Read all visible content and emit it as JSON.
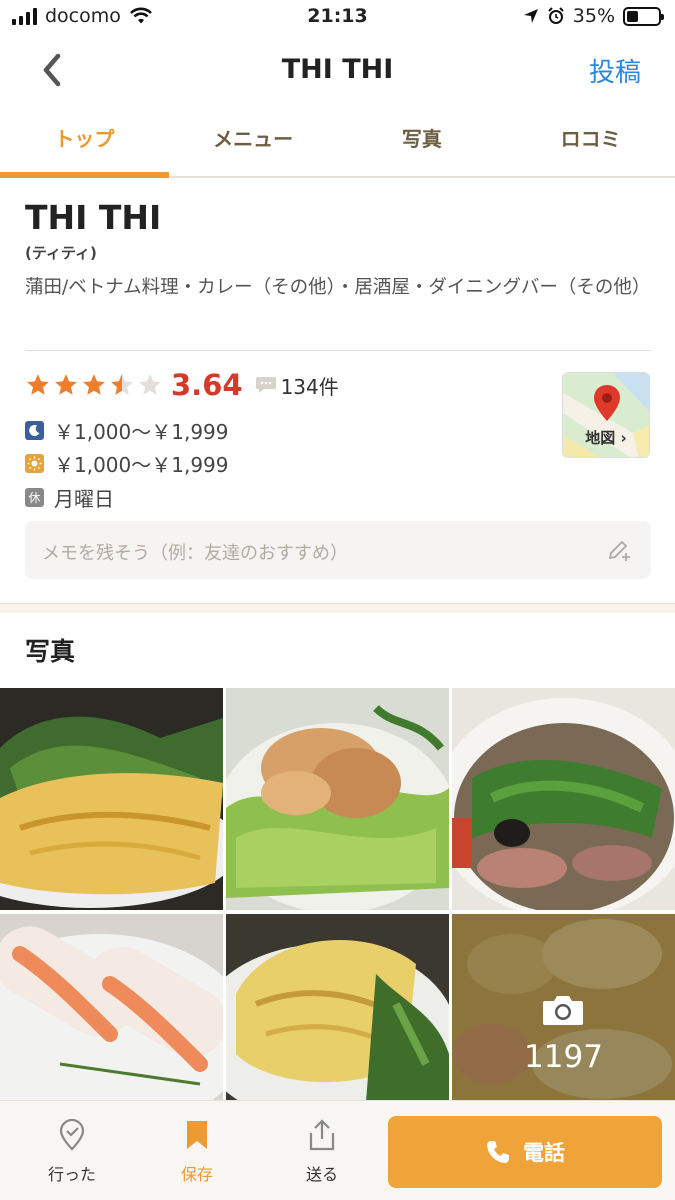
{
  "status": {
    "carrier": "docomo",
    "time": "21:13",
    "battery": "35%",
    "battery_level": 0.35
  },
  "nav": {
    "title": "THI THI",
    "post_label": "投稿"
  },
  "tabs": [
    {
      "label": "トップ",
      "active": true
    },
    {
      "label": "メニュー",
      "active": false
    },
    {
      "label": "写真",
      "active": false
    },
    {
      "label": "ロコミ",
      "active": false
    }
  ],
  "shop": {
    "name": "THI THI",
    "kana": "(ティティ)",
    "genre": "蒲田/ベトナム料理・カレー（その他）・居酒屋・ダイニングバー（その他）",
    "rating": 3.64,
    "rating_label": "3.64",
    "stars_filled": 3.5,
    "review_count": "134件",
    "dinner_price": "￥1,000～￥1,999",
    "lunch_price": "￥1,000～￥1,999",
    "holiday_badge": "休",
    "holiday": "月曜日",
    "map_label": "地図"
  },
  "memo": {
    "placeholder": "メモを残そう（例：友達のおすすめ）"
  },
  "photos": {
    "title": "写真",
    "total": "1197"
  },
  "bottom": {
    "went": "行った",
    "save": "保存",
    "send": "送る",
    "call": "電話"
  },
  "colors": {
    "accent": "#ed9a32",
    "score": "#d43a2a",
    "link": "#2e86de",
    "dinner": "#3a5f9c",
    "lunch": "#e8a23c"
  }
}
